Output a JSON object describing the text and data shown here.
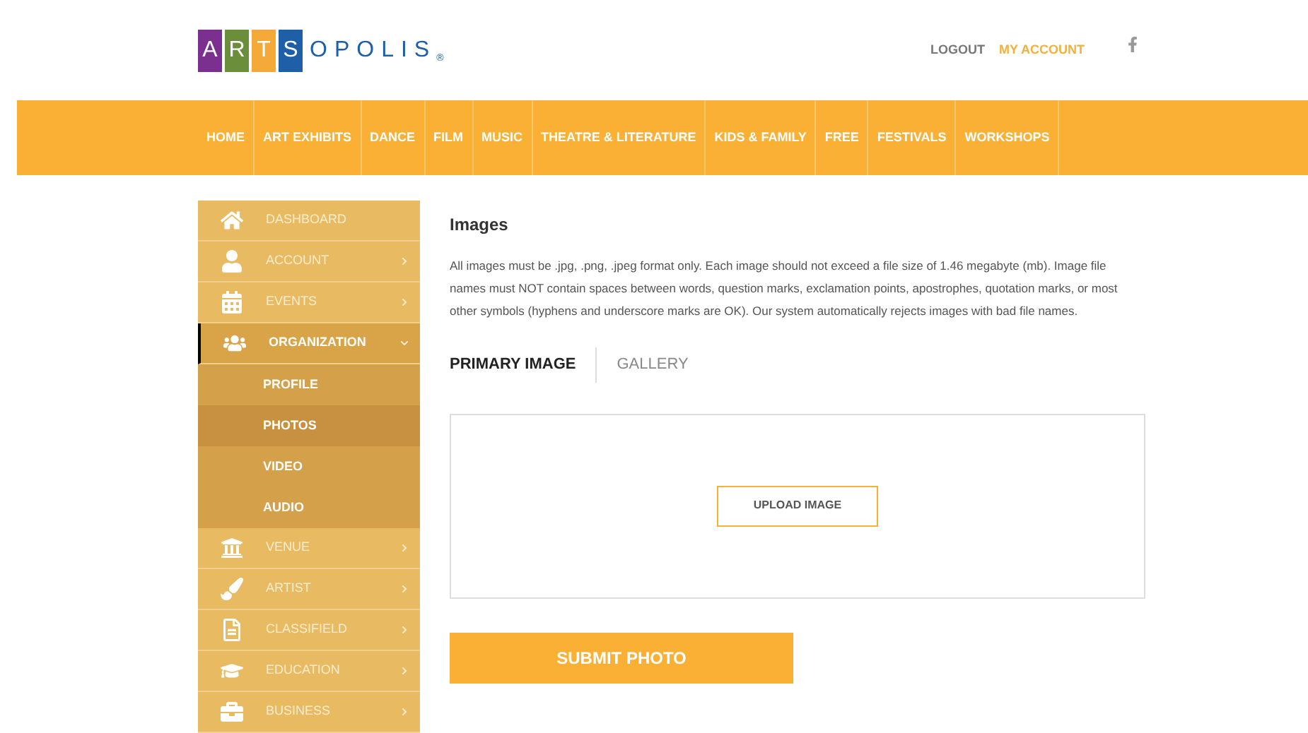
{
  "logo": {
    "tiles": [
      {
        "letter": "A",
        "color": "#7b2f8e"
      },
      {
        "letter": "R",
        "color": "#6b8e3a"
      },
      {
        "letter": "T",
        "color": "#f4a939"
      },
      {
        "letter": "S",
        "color": "#1f5fa8"
      }
    ],
    "rest": "OPOLIS",
    "mark": "®"
  },
  "header_links": [
    {
      "label": "LOGOUT",
      "selected": false
    },
    {
      "label": "MY ACCOUNT",
      "selected": true
    }
  ],
  "nav": [
    "HOME",
    "ART EXHIBITS",
    "DANCE",
    "FILM",
    "MUSIC",
    "THEATRE & LITERATURE",
    "KIDS & FAMILY",
    "FREE",
    "FESTIVALS",
    "WORKSHOPS"
  ],
  "sidebar": {
    "items": [
      {
        "label": "DASHBOARD",
        "kind": "link",
        "selected": false
      },
      {
        "label": "ACCOUNT",
        "kind": "menu",
        "selected": false,
        "expanded": false
      },
      {
        "label": "EVENTS",
        "kind": "menu",
        "selected": false,
        "expanded": false
      },
      {
        "label": "ORGANIZATION",
        "kind": "menu",
        "selected": true,
        "expanded": true,
        "children": [
          {
            "label": "PROFILE",
            "selected": false
          },
          {
            "label": "PHOTOS",
            "selected": true
          },
          {
            "label": "VIDEO",
            "selected": false
          },
          {
            "label": "AUDIO",
            "selected": false
          }
        ]
      },
      {
        "label": "VENUE",
        "kind": "menu",
        "selected": false,
        "expanded": false
      },
      {
        "label": "ARTIST",
        "kind": "menu",
        "selected": false,
        "expanded": false
      },
      {
        "label": "CLASSIFIELD",
        "kind": "menu",
        "selected": false,
        "expanded": false
      },
      {
        "label": "EDUCATION",
        "kind": "menu",
        "selected": false,
        "expanded": false
      },
      {
        "label": "BUSINESS",
        "kind": "menu",
        "selected": false,
        "expanded": false
      }
    ]
  },
  "main": {
    "heading": "Images",
    "description": "All images must be .jpg, .png, .jpeg format only. Each image should not exceed a file size of 1.46 megabyte (mb). Image file names must NOT contain spaces between words, question marks, exclamation points, apostrophes, quotation marks, or most other symbols (hyphens and underscore marks are OK). Our system automatically rejects images with bad file names.",
    "tabs": [
      {
        "label": "PRIMARY IMAGE",
        "selected": true
      },
      {
        "label": "GALLERY",
        "selected": false
      }
    ],
    "upload_button": "UPLOAD IMAGE",
    "submit_button": "SUBMIT PHOTO"
  }
}
